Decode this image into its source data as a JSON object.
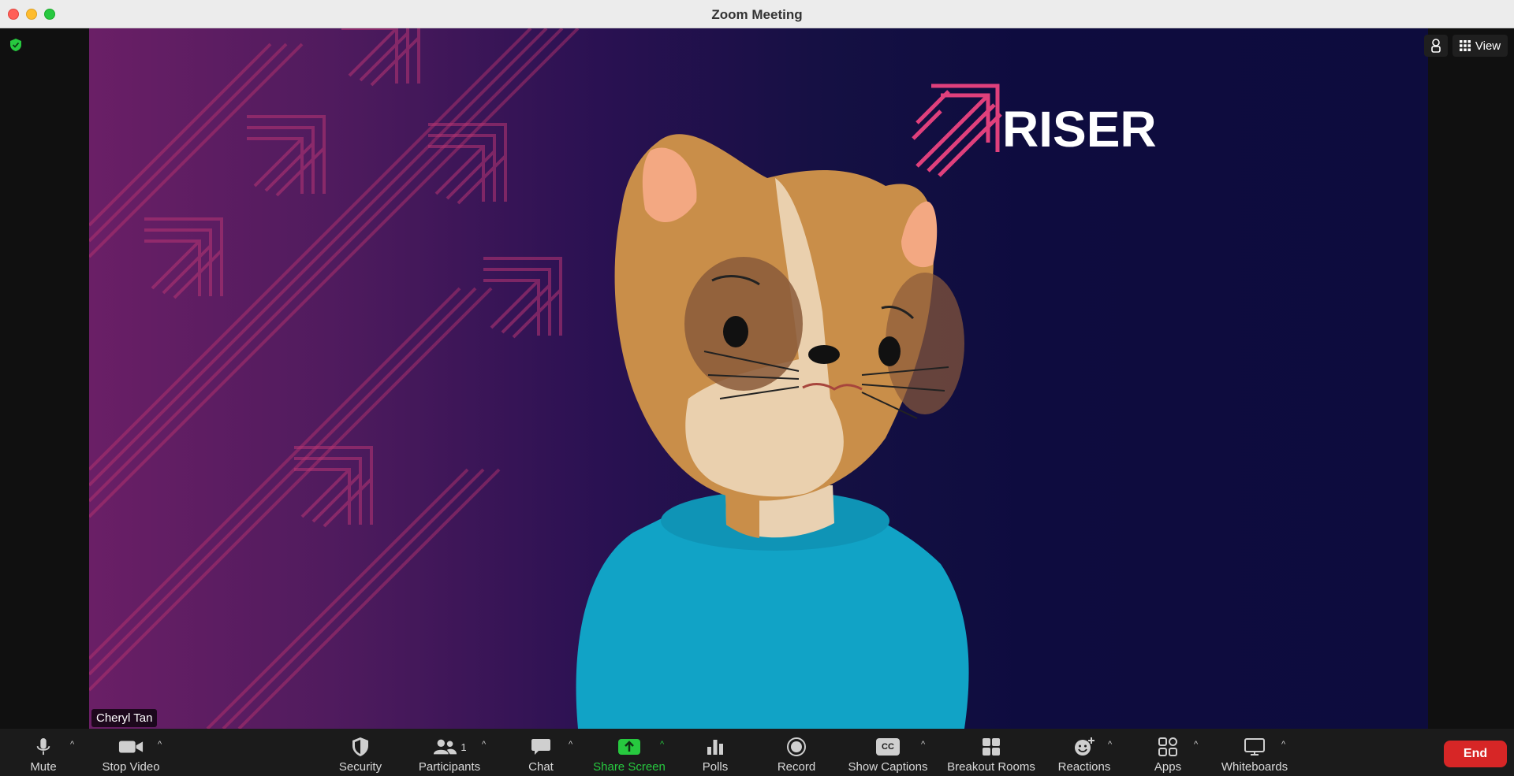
{
  "window": {
    "title": "Zoom Meeting"
  },
  "video": {
    "participant_name": "Cheryl Tan",
    "brand_text": "RISER"
  },
  "top_right": {
    "view_label": "View"
  },
  "toolbar": {
    "mute_label": "Mute",
    "stop_video_label": "Stop Video",
    "security_label": "Security",
    "participants_label": "Participants",
    "participants_count": "1",
    "chat_label": "Chat",
    "share_screen_label": "Share Screen",
    "polls_label": "Polls",
    "record_label": "Record",
    "show_captions_label": "Show Captions",
    "cc_text": "CC",
    "breakout_rooms_label": "Breakout Rooms",
    "reactions_label": "Reactions",
    "apps_label": "Apps",
    "whiteboards_label": "Whiteboards",
    "end_label": "End"
  },
  "colors": {
    "share_green": "#27c93f",
    "end_red": "#d72626",
    "brand_pink": "#e0407c",
    "shirt_teal": "#11a3c6"
  },
  "icons": [
    "shield-check-icon",
    "microphone-icon",
    "video-camera-icon",
    "security-shield-icon",
    "participants-icon",
    "chat-bubble-icon",
    "share-screen-icon",
    "polls-icon",
    "record-icon",
    "captions-icon",
    "breakout-rooms-icon",
    "reactions-icon",
    "apps-icon",
    "whiteboards-icon",
    "grid-icon",
    "caret-up-icon"
  ]
}
